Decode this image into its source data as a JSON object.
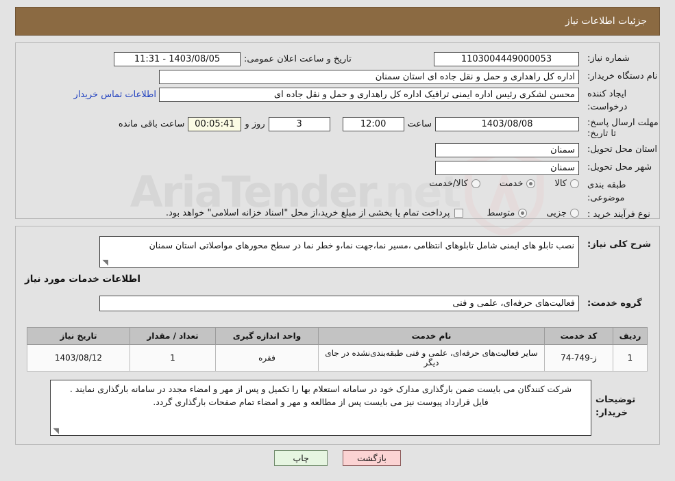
{
  "header": {
    "title": "جزئیات اطلاعات نیاز"
  },
  "watermark": {
    "text_main": "AriaTender",
    "text_suffix": ".net"
  },
  "form": {
    "need_number": {
      "label": "شماره نیاز:",
      "value": "1103004449000053"
    },
    "buyer_org": {
      "label": "نام دستگاه خریدار:",
      "value": "اداره کل راهداری و حمل و نقل جاده ای استان سمنان"
    },
    "requester": {
      "label": "ایجاد کننده درخواست:",
      "value": "محسن لشکری رئیس اداره ایمنی ترافیک اداره کل راهداری و حمل و نقل جاده ای",
      "contact_link": "اطلاعات تماس خریدار"
    },
    "announce": {
      "label": "تاریخ و ساعت اعلان عمومی:",
      "value": "1403/08/05 - 11:31"
    },
    "deadline": {
      "label": "مهلت ارسال پاسخ: تا تاریخ:",
      "date": "1403/08/08",
      "hour_label": "ساعت",
      "hour": "12:00",
      "days": "3",
      "days_label": "روز و",
      "countdown": "00:05:41",
      "remaining_label": "ساعت باقی مانده"
    },
    "province": {
      "label": "استان محل تحویل:",
      "value": "سمنان"
    },
    "city": {
      "label": "شهر محل تحویل:",
      "value": "سمنان"
    },
    "category": {
      "label": "طبقه بندی موضوعی:",
      "options": [
        {
          "label": "کالا",
          "selected": false
        },
        {
          "label": "خدمت",
          "selected": true
        },
        {
          "label": "کالا/خدمت",
          "selected": false
        }
      ]
    },
    "purchase_type": {
      "label": "نوع فرآیند خرید :",
      "options": [
        {
          "label": "جزیی",
          "selected": false
        },
        {
          "label": "متوسط",
          "selected": true
        }
      ],
      "checkbox_label": "پرداخت تمام یا بخشی از مبلغ خرید،از محل \"اسناد خزانه اسلامی\" خواهد بود.",
      "checkbox_checked": false
    },
    "description": {
      "label": "شرح کلی نیاز:",
      "value": "نصب تابلو های ایمنی شامل تابلوهای انتظامی ،مسیر نما،جهت نما،و خطر نما در سطح محورهای مواصلاتی استان سمنان"
    },
    "services_heading": "اطلاعات خدمات مورد نیاز",
    "service_group": {
      "label": "گروه خدمت:",
      "value": "فعالیت‌های حرفه‌ای، علمی و فنی"
    },
    "buyer_notes": {
      "label": "توضیحات خریدار:",
      "line1": "شرکت کنندگان می بایست ضمن بارگذاری مدارک خود در سامانه استعلام بها را تکمیل و پس از مهر و امضاء مجدد در سامانه بارگذاری نمایند .",
      "line2": "فایل قرارداد پیوست نیز می بایست پس از مطالعه و مهر و امضاء تمام صفحات بارگذاری گردد."
    }
  },
  "table": {
    "columns": [
      "ردیف",
      "کد خدمت",
      "نام خدمت",
      "واحد اندازه گیری",
      "تعداد / مقدار",
      "تاریخ نیاز"
    ],
    "rows": [
      {
        "radif": "1",
        "code": "ز-749-74",
        "name": "سایر فعالیت‌های حرفه‌ای، علمی و فنی طبقه‌بندی‌نشده در جای دیگر",
        "unit": "فقره",
        "qty": "1",
        "date": "1403/08/12"
      }
    ]
  },
  "buttons": {
    "back": "بازگشت",
    "print": "چاپ"
  }
}
